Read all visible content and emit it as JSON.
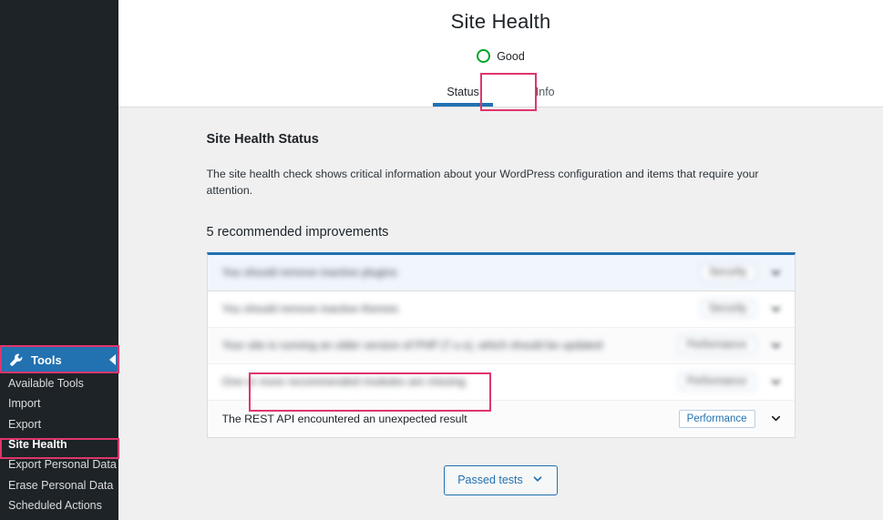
{
  "sidebar": {
    "tools": {
      "label": "Tools",
      "icon": "wrench-icon",
      "arrow_icon": "arrow-left-icon"
    },
    "items": [
      {
        "label": "Available Tools",
        "current": false
      },
      {
        "label": "Import",
        "current": false
      },
      {
        "label": "Export",
        "current": false
      },
      {
        "label": "Site Health",
        "current": true
      },
      {
        "label": "Export Personal Data",
        "current": false
      },
      {
        "label": "Erase Personal Data",
        "current": false
      },
      {
        "label": "Scheduled Actions",
        "current": false
      }
    ]
  },
  "header": {
    "title": "Site Health",
    "status_label": "Good",
    "status_icon": "circle-ring-icon",
    "status_color": "#00a32a",
    "tabs": [
      {
        "label": "Status",
        "active": true
      },
      {
        "label": "Info",
        "active": false
      }
    ]
  },
  "content": {
    "section_title": "Site Health Status",
    "section_description": "The site health check shows critical information about your WordPress configuration and items that require your attention.",
    "issues_heading": "5 recommended improvements",
    "rows": [
      {
        "title": "You should remove inactive plugins",
        "badge": "Security",
        "blurred": true,
        "focused": true
      },
      {
        "title": "You should remove inactive themes",
        "badge": "Security",
        "blurred": true,
        "focused": false
      },
      {
        "title": "Your site is running an older version of PHP (7.x.x), which should be updated",
        "badge": "Performance",
        "blurred": true,
        "focused": false
      },
      {
        "title": "One or more recommended modules are missing",
        "badge": "Performance",
        "blurred": true,
        "focused": false
      },
      {
        "title": "The REST API encountered an unexpected result",
        "badge": "Performance",
        "blurred": false,
        "focused": false
      }
    ],
    "passed_tests_label": "Passed tests",
    "passed_tests_icon": "chevron-down-icon"
  },
  "highlights": {
    "accent_color": "#e0356b",
    "targets": [
      "tab-status",
      "sidebar-item-tools",
      "sidebar-item-site-health",
      "row-rest-api"
    ]
  }
}
